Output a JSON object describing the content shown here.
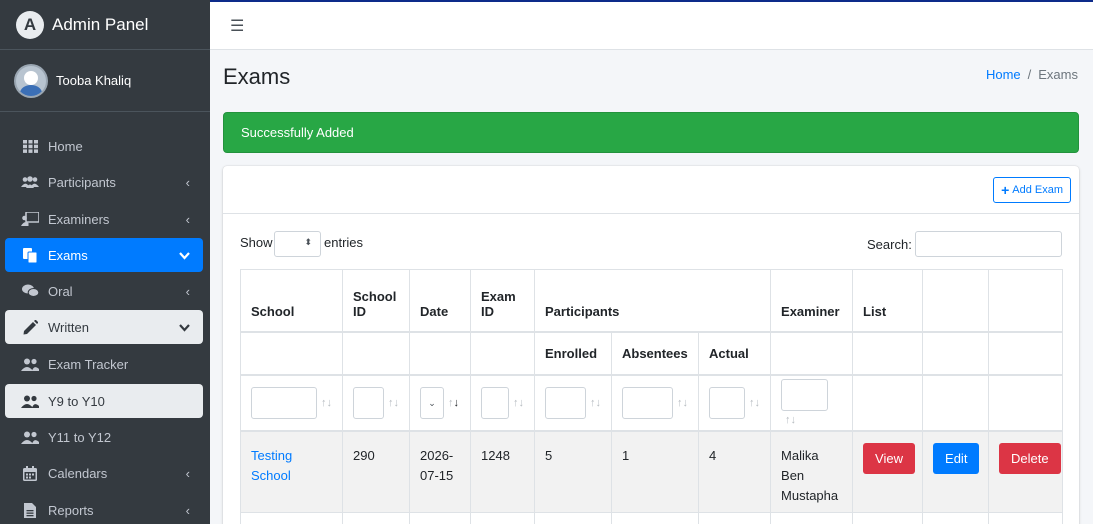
{
  "app": {
    "brand": "Admin Panel",
    "logo_letter": "A"
  },
  "user": {
    "name": "Tooba Khaliq"
  },
  "sidebar": {
    "items": [
      {
        "label": "Home",
        "icon": "grid-icon"
      },
      {
        "label": "Participants",
        "icon": "users-icon",
        "chevron": "‹"
      },
      {
        "label": "Examiners",
        "icon": "chalkboard-teacher-icon",
        "chevron": "‹"
      },
      {
        "label": "Exams",
        "icon": "copy-icon",
        "chevron": "⌄"
      },
      {
        "label": "Oral",
        "icon": "comments-icon",
        "chevron": "‹"
      },
      {
        "label": "Written",
        "icon": "pen-icon",
        "chevron": "⌄"
      },
      {
        "label": "Exam Tracker",
        "icon": "user-friends-icon"
      },
      {
        "label": "Y9 to Y10",
        "icon": "user-friends-icon"
      },
      {
        "label": "Y11 to Y12",
        "icon": "user-friends-icon"
      },
      {
        "label": "Calendars",
        "icon": "calendar-icon",
        "chevron": "‹"
      },
      {
        "label": "Reports",
        "icon": "file-icon",
        "chevron": "‹"
      }
    ]
  },
  "topbar": {
    "menu_icon": "☰"
  },
  "page": {
    "title": "Exams"
  },
  "breadcrumb": {
    "home": "Home",
    "separator": "/",
    "current": "Exams"
  },
  "alert": {
    "text": "Successfully Added"
  },
  "toolbar": {
    "add_label": "Add Exam",
    "add_icon": "+"
  },
  "datatable": {
    "show_label": "Show",
    "entries_label": "entries",
    "search_label": "Search:",
    "select_arrow": "⬍"
  },
  "table": {
    "headers": {
      "school": "School",
      "school_id_1": "School",
      "school_id_2": "ID",
      "date": "Date",
      "exam_id_1": "Exam",
      "exam_id_2": "ID",
      "participants": "Participants",
      "enrolled": "Enrolled",
      "absentees": "Absentees",
      "actual": "Actual",
      "examiner": "Examiner",
      "list": "List"
    },
    "row": {
      "school_1": "Testing",
      "school_2": "School",
      "school_id": "290",
      "date_1": "2026-",
      "date_2": "07-15",
      "exam_id": "1248",
      "enrolled": "5",
      "absentees": "1",
      "actual": "4",
      "examiner_1": "Malika",
      "examiner_2": "Ben",
      "examiner_3": "Mustapha",
      "view_label": "View",
      "edit_label": "Edit",
      "delete_label": "Delete"
    }
  },
  "colors": {
    "sidebar": "#343a40",
    "active": "#007bff",
    "success": "#28a745",
    "danger": "#dc3545"
  }
}
